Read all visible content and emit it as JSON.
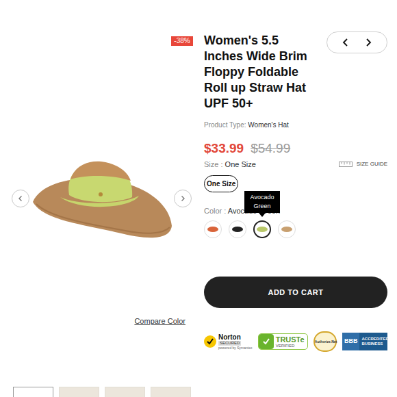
{
  "badge": "-38%",
  "title": "Women's 5.5 Inches Wide Brim Floppy Foldable Roll up Straw Hat UPF 50+",
  "product_type": {
    "label": "Product Type:",
    "value": "Women's Hat"
  },
  "price": {
    "current": "$33.99",
    "original": "$54.99"
  },
  "size": {
    "label": "Size :",
    "value": "One Size",
    "options": [
      {
        "label": "One Size",
        "selected": true
      }
    ]
  },
  "size_guide": "SIZE GUIDE",
  "color": {
    "label": "Color :",
    "value": "Avocado Green",
    "tooltip": "Avocado Green",
    "swatches": [
      {
        "selected": false,
        "color": "#d9643a"
      },
      {
        "selected": false,
        "color": "#222222"
      },
      {
        "selected": true,
        "color": "#b9c86a"
      },
      {
        "selected": false,
        "color": "#c8a070"
      }
    ]
  },
  "add_to_cart": "ADD TO CART",
  "compare_color": "Compare Color",
  "trust_badges": [
    {
      "kind": "norton",
      "lines": [
        "Norton",
        "SECURED",
        "powered by Symantec"
      ]
    },
    {
      "kind": "truste",
      "lines": [
        "TRUSTe",
        "VERIFIED"
      ]
    },
    {
      "kind": "authorize",
      "lines": [
        "Authorize.Net"
      ]
    },
    {
      "kind": "bbb",
      "lines": [
        "BBB",
        "ACCREDITED",
        "BUSINESS"
      ]
    }
  ],
  "thumbnails": [
    {
      "selected": true
    },
    {
      "selected": false
    },
    {
      "selected": false
    },
    {
      "selected": false
    }
  ]
}
